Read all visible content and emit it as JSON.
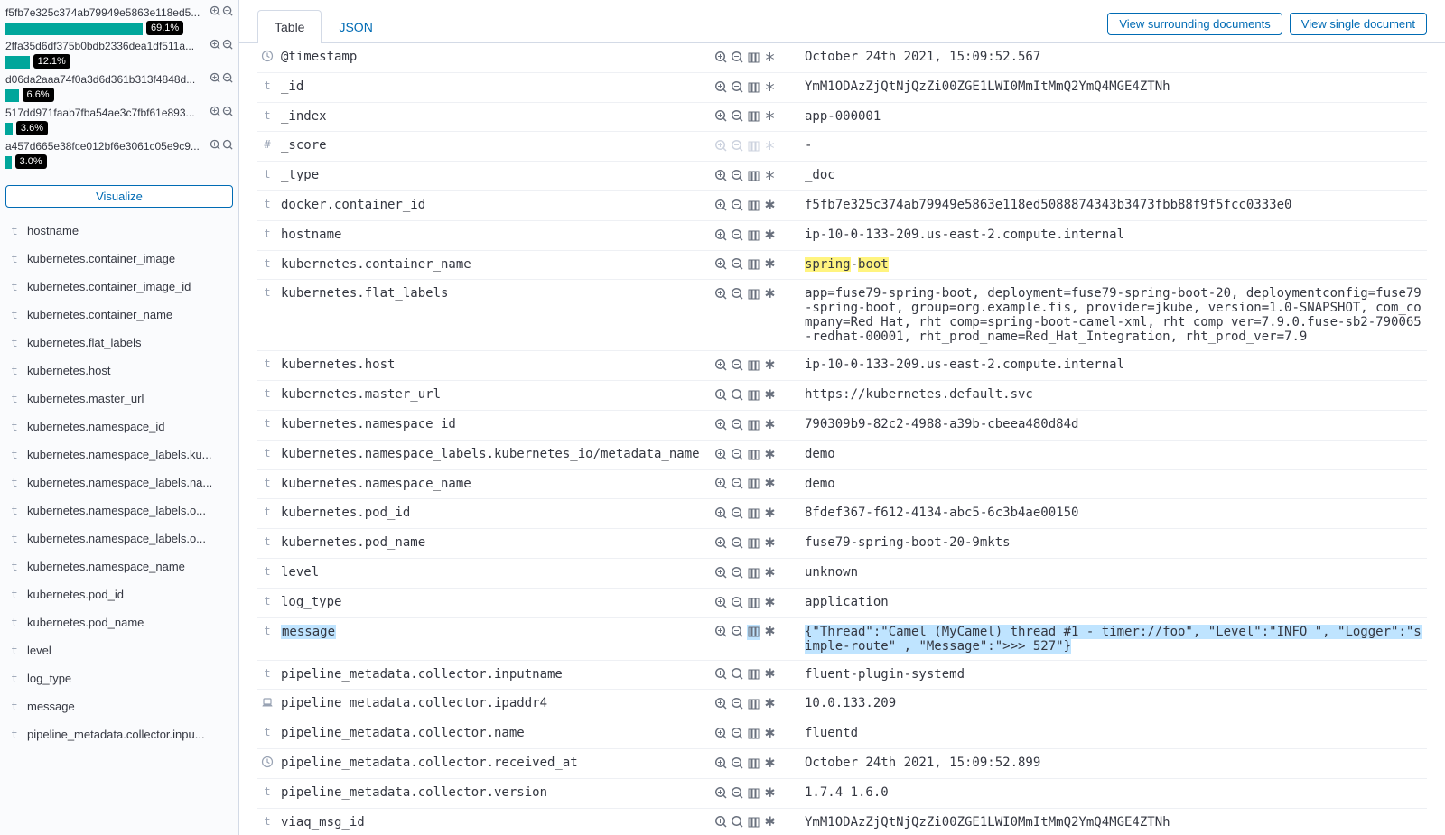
{
  "sidebar": {
    "buckets": [
      {
        "label": "f5fb7e325c374ab79949e5863e118ed5...",
        "pct_label": "69.1%",
        "pct": 69.1
      },
      {
        "label": "2ffa35d6df375b0bdb2336dea1df511a...",
        "pct_label": "12.1%",
        "pct": 12.1
      },
      {
        "label": "d06da2aaa74f0a3d6d361b313f4848d...",
        "pct_label": "6.6%",
        "pct": 6.6
      },
      {
        "label": "517dd971faab7fba54ae3c7fbf61e893...",
        "pct_label": "3.6%",
        "pct": 3.6
      },
      {
        "label": "a457d665e38fce012bf6e3061c05e9c9...",
        "pct_label": "3.0%",
        "pct": 3.0
      }
    ],
    "visualize_label": "Visualize",
    "fields": [
      {
        "type": "t",
        "name": "hostname"
      },
      {
        "type": "t",
        "name": "kubernetes.container_image"
      },
      {
        "type": "t",
        "name": "kubernetes.container_image_id"
      },
      {
        "type": "t",
        "name": "kubernetes.container_name"
      },
      {
        "type": "t",
        "name": "kubernetes.flat_labels"
      },
      {
        "type": "t",
        "name": "kubernetes.host"
      },
      {
        "type": "t",
        "name": "kubernetes.master_url"
      },
      {
        "type": "t",
        "name": "kubernetes.namespace_id"
      },
      {
        "type": "t",
        "name": "kubernetes.namespace_labels.ku..."
      },
      {
        "type": "t",
        "name": "kubernetes.namespace_labels.na..."
      },
      {
        "type": "t",
        "name": "kubernetes.namespace_labels.o..."
      },
      {
        "type": "t",
        "name": "kubernetes.namespace_labels.o..."
      },
      {
        "type": "t",
        "name": "kubernetes.namespace_name"
      },
      {
        "type": "t",
        "name": "kubernetes.pod_id"
      },
      {
        "type": "t",
        "name": "kubernetes.pod_name"
      },
      {
        "type": "t",
        "name": "level"
      },
      {
        "type": "t",
        "name": "log_type"
      },
      {
        "type": "t",
        "name": "message"
      },
      {
        "type": "t",
        "name": "pipeline_metadata.collector.inpu..."
      }
    ]
  },
  "header": {
    "tab_table": "Table",
    "tab_json": "JSON",
    "surrounding": "View surrounding documents",
    "single": "View single document"
  },
  "rows": [
    {
      "type": "clock",
      "name": "@timestamp",
      "value": "October 24th 2021, 15:09:52.567",
      "exists": "asterisk"
    },
    {
      "type": "t",
      "name": "_id",
      "value": "YmM1ODAzZjQtNjQzZi00ZGE1LWI0MmItMmQ2YmQ4MGE4ZTNh",
      "exists": "asterisk"
    },
    {
      "type": "t",
      "name": "_index",
      "value": "app-000001",
      "exists": "asterisk"
    },
    {
      "type": "#",
      "name": "_score",
      "value": " - ",
      "dim": true,
      "exists": "asterisk"
    },
    {
      "type": "t",
      "name": "_type",
      "value": "_doc",
      "exists": "asterisk"
    },
    {
      "type": "t",
      "name": "docker.container_id",
      "value": "f5fb7e325c374ab79949e5863e118ed5088874343b3473fbb88f9f5fcc0333e0",
      "exists": "bold"
    },
    {
      "type": "t",
      "name": "hostname",
      "value": "ip-10-0-133-209.us-east-2.compute.internal",
      "exists": "bold"
    },
    {
      "type": "t",
      "name": "kubernetes.container_name",
      "value_html": "<span class=\"hl-yellow\">spring</span>-<span class=\"hl-yellow\">boot</span>",
      "exists": "bold"
    },
    {
      "type": "t",
      "name": "kubernetes.flat_labels",
      "value": "app=fuse79-spring-boot, deployment=fuse79-spring-boot-20, deploymentconfig=fuse79-spring-boot, group=org.example.fis, provider=jkube, version=1.0-SNAPSHOT, com_company=Red_Hat, rht_comp=spring-boot-camel-xml, rht_comp_ver=7.9.0.fuse-sb2-790065-redhat-00001, rht_prod_name=Red_Hat_Integration, rht_prod_ver=7.9",
      "exists": "bold"
    },
    {
      "type": "t",
      "name": "kubernetes.host",
      "value": "ip-10-0-133-209.us-east-2.compute.internal",
      "exists": "bold"
    },
    {
      "type": "t",
      "name": "kubernetes.master_url",
      "value": "https://kubernetes.default.svc",
      "exists": "bold"
    },
    {
      "type": "t",
      "name": "kubernetes.namespace_id",
      "value": "790309b9-82c2-4988-a39b-cbeea480d84d",
      "exists": "bold"
    },
    {
      "type": "t",
      "name": "kubernetes.namespace_labels.kubernetes_io/metadata_name",
      "value": "demo",
      "exists": "bold"
    },
    {
      "type": "t",
      "name": "kubernetes.namespace_name",
      "value": "demo",
      "exists": "bold"
    },
    {
      "type": "t",
      "name": "kubernetes.pod_id",
      "value": "8fdef367-f612-4134-abc5-6c3b4ae00150",
      "exists": "bold"
    },
    {
      "type": "t",
      "name": "kubernetes.pod_name",
      "value": "fuse79-spring-boot-20-9mkts",
      "exists": "bold"
    },
    {
      "type": "t",
      "name": "level",
      "value": "unknown",
      "exists": "bold"
    },
    {
      "type": "t",
      "name": "log_type",
      "value": "application",
      "exists": "bold"
    },
    {
      "type": "t",
      "name": "message",
      "name_html": "<span class=\"hl-sel\">message</span>",
      "value_html": "<span class=\"hl-sel\">{\"Thread\":\"Camel (MyCamel) thread #1 - timer://foo\", \"Level\":\"INFO \", \"Logger\":\"si</span><span class=\"hl-sel\">mple-route\" , \"Message\":\">>> 527\"}</span>",
      "exists": "bold",
      "selected": true
    },
    {
      "type": "t",
      "name": "pipeline_metadata.collector.inputname",
      "value": "fluent-plugin-systemd",
      "exists": "bold"
    },
    {
      "type": "laptop",
      "name": "pipeline_metadata.collector.ipaddr4",
      "value": "10.0.133.209",
      "exists": "bold"
    },
    {
      "type": "t",
      "name": "pipeline_metadata.collector.name",
      "value": "fluentd",
      "exists": "bold"
    },
    {
      "type": "clock",
      "name": "pipeline_metadata.collector.received_at",
      "value": "October 24th 2021, 15:09:52.899",
      "exists": "bold"
    },
    {
      "type": "t",
      "name": "pipeline_metadata.collector.version",
      "value": "1.7.4 1.6.0",
      "exists": "bold"
    },
    {
      "type": "t",
      "name": "viaq_msg_id",
      "value": "YmM1ODAzZjQtNjQzZi00ZGE1LWI0MmItMmQ2YmQ4MGE4ZTNh",
      "exists": "bold"
    }
  ]
}
